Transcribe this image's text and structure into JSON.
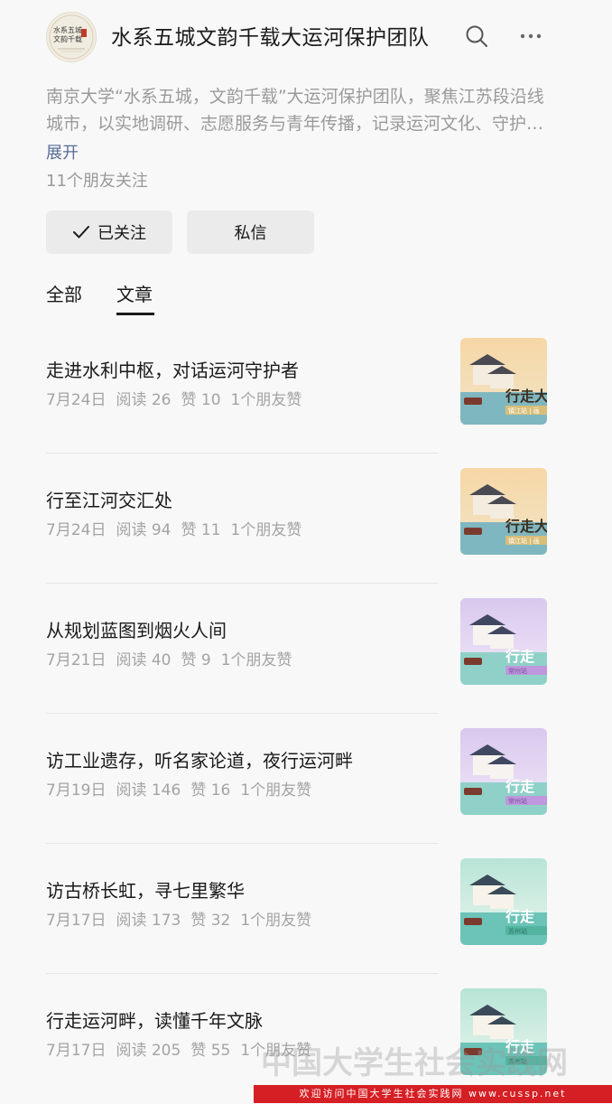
{
  "account": {
    "name": "水系五城文韵千载大运河保护团队",
    "description": "南京大学“水系五城，文韵千载”大运河保护团队，聚焦江苏段沿线城市，以实地调研、志愿服务与青年传播，记录运河文化、守护千年文脉。",
    "expand_label": "展开",
    "friends_following": "11个朋友关注",
    "follow_label": "已关注",
    "message_label": "私信",
    "avatar_text": [
      "水系五城",
      "文韵千载"
    ]
  },
  "tabs": [
    "全部",
    "文章"
  ],
  "articles": [
    {
      "title": "走进水利中枢，对话运河守护者",
      "date": "7月24日",
      "reads": "阅读 26",
      "likes": "赞 10",
      "friends": "1个朋友赞",
      "thumb": "warm",
      "thumb_text": "行走大",
      "thumb_sub": "镇江站 | 画"
    },
    {
      "title": "行至江河交汇处",
      "date": "7月24日",
      "reads": "阅读 94",
      "likes": "赞 11",
      "friends": "1个朋友赞",
      "thumb": "warm",
      "thumb_text": "行走大",
      "thumb_sub": "镇江站 | 画"
    },
    {
      "title": "从规划蓝图到烟火人间",
      "date": "7月21日",
      "reads": "阅读 40",
      "likes": "赞 9",
      "friends": "1个朋友赞",
      "thumb": "lilac",
      "thumb_text": "行走",
      "thumb_sub": "常州站"
    },
    {
      "title": "访工业遗存，听名家论道，夜行运河畔",
      "date": "7月19日",
      "reads": "阅读 146",
      "likes": "赞 16",
      "friends": "1个朋友赞",
      "thumb": "lilac",
      "thumb_text": "行走",
      "thumb_sub": "常州站"
    },
    {
      "title": "访古桥长虹，寻七里繁华",
      "date": "7月17日",
      "reads": "阅读 173",
      "likes": "赞 32",
      "friends": "1个朋友赞",
      "thumb": "teal",
      "thumb_text": "行走",
      "thumb_sub": "苏州站"
    },
    {
      "title": "行走运河畔，读懂千年文脉",
      "date": "7月17日",
      "reads": "阅读 205",
      "likes": "赞 55",
      "friends": "1个朋友赞",
      "thumb": "teal",
      "thumb_text": "行走",
      "thumb_sub": "苏州站"
    }
  ],
  "watermark": {
    "text": "欢迎访问中国大学生社会实践网 www.cussp.net",
    "logo_text": "中国大学生社会实践网"
  },
  "colors": {
    "link": "#576b95",
    "muted": "#9a9a9a",
    "watermark_red": "#d61f24"
  }
}
